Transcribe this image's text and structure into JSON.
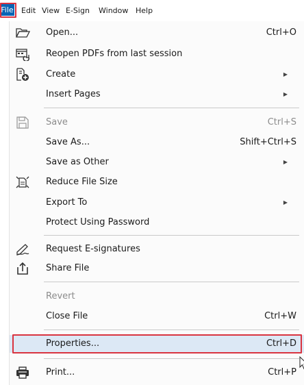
{
  "menubar": {
    "items": [
      "File",
      "Edit",
      "View",
      "E-Sign",
      "Window",
      "Help"
    ]
  },
  "menu": {
    "items": [
      {
        "label": "Open...",
        "shortcut": "Ctrl+O",
        "icon": "open-folder-icon"
      },
      {
        "label": "Reopen PDFs from last session",
        "shortcut": "",
        "icon": "reopen-icon"
      },
      {
        "label": "Create",
        "shortcut": "",
        "icon": "create-icon",
        "submenu": true
      },
      {
        "label": "Insert Pages",
        "shortcut": "",
        "submenu": true
      },
      {
        "label": "Save",
        "shortcut": "Ctrl+S",
        "icon": "save-icon",
        "disabled": true
      },
      {
        "label": "Save As...",
        "shortcut": "Shift+Ctrl+S"
      },
      {
        "label": "Save as Other",
        "shortcut": "",
        "submenu": true
      },
      {
        "label": "Reduce File Size",
        "shortcut": "",
        "icon": "reduce-file-size-icon"
      },
      {
        "label": "Export To",
        "shortcut": "",
        "submenu": true
      },
      {
        "label": "Protect Using Password",
        "shortcut": ""
      },
      {
        "label": "Request E-signatures",
        "shortcut": "",
        "icon": "e-signature-icon"
      },
      {
        "label": "Share File",
        "shortcut": "",
        "icon": "share-icon"
      },
      {
        "label": "Revert",
        "shortcut": "",
        "disabled": true
      },
      {
        "label": "Close File",
        "shortcut": "Ctrl+W"
      },
      {
        "label": "Properties...",
        "shortcut": "Ctrl+D",
        "highlighted": true
      },
      {
        "label": "Print...",
        "shortcut": "Ctrl+P",
        "icon": "printer-icon"
      }
    ]
  },
  "colors": {
    "accent": "#0a64b4",
    "highlight_border": "#d9333f",
    "hover": "#dce8f5"
  }
}
